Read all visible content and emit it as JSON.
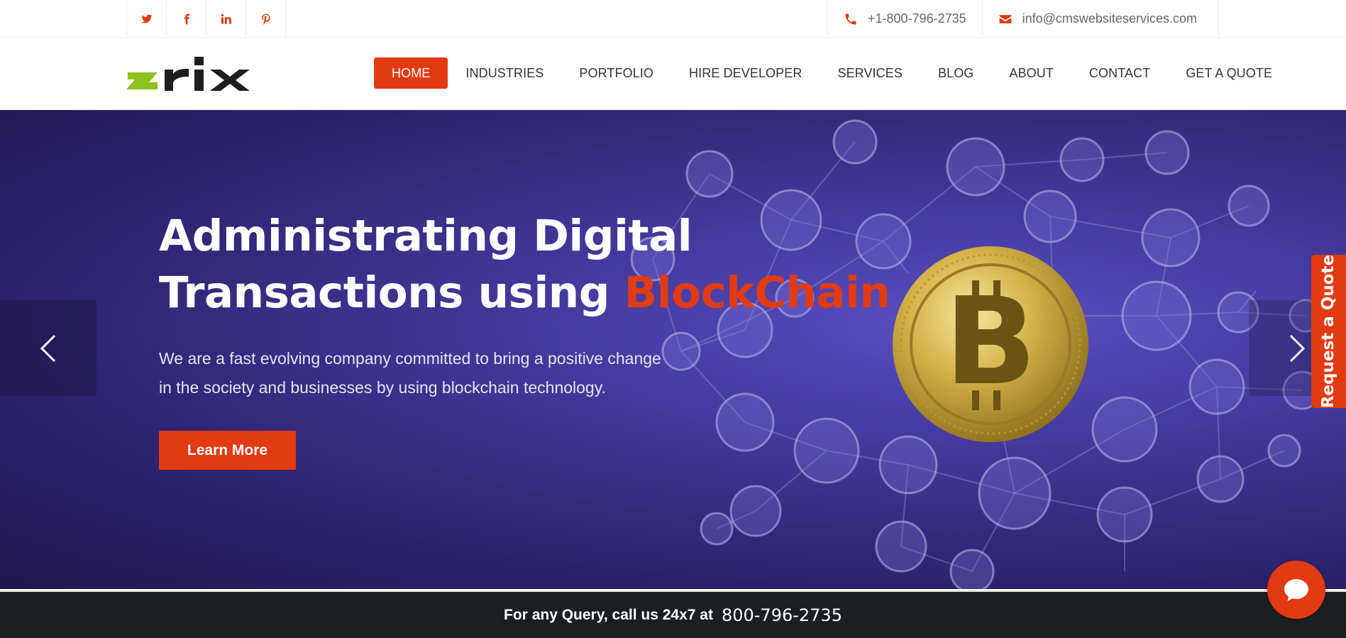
{
  "topbar": {
    "social": [
      {
        "name": "twitter-icon"
      },
      {
        "name": "facebook-icon"
      },
      {
        "name": "linkedin-icon"
      },
      {
        "name": "pinterest-icon"
      }
    ],
    "phone": "+1-800-796-2735",
    "email": "info@cmswebsiteservices.com"
  },
  "header": {
    "logo_text": "zrix",
    "nav": [
      {
        "label": "HOME",
        "active": true
      },
      {
        "label": "INDUSTRIES"
      },
      {
        "label": "PORTFOLIO"
      },
      {
        "label": "HIRE DEVELOPER"
      },
      {
        "label": "SERVICES"
      },
      {
        "label": "BLOG"
      },
      {
        "label": "ABOUT"
      },
      {
        "label": "CONTACT"
      },
      {
        "label": "GET A QUOTE"
      }
    ]
  },
  "hero": {
    "title_line1": "Administrating Digital",
    "title_line2": "Transactions using ",
    "title_accent": "BlockChain",
    "subtitle_line1": "We are a fast evolving company committed to bring a positive change",
    "subtitle_line2": "in the society and businesses by using blockchain technology.",
    "cta": "Learn More"
  },
  "side_tab": "Request a Quote",
  "callbar": {
    "label": "For any Query, call us 24x7 at",
    "number": "800-796-2735"
  },
  "colors": {
    "accent": "#e23a11",
    "logo_green": "#8dc21f",
    "hero_bg": "#2f2572",
    "callbar_bg": "#1c1f22"
  }
}
